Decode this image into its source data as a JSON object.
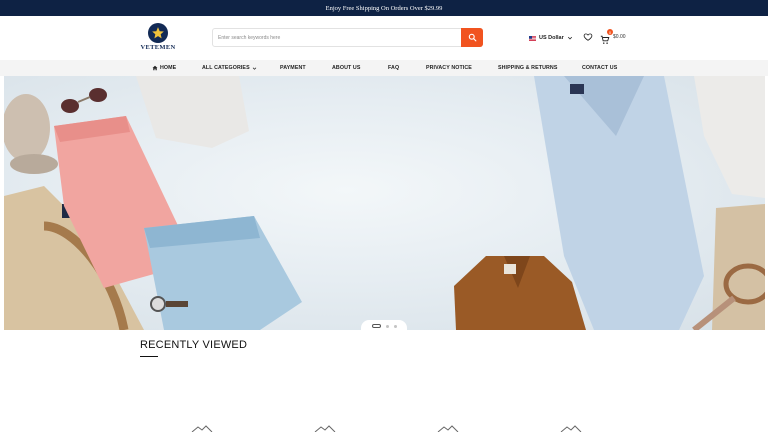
{
  "topbar": {
    "text": "Enjoy Free Shipping On Orders Over $29.99"
  },
  "header": {
    "logo_text": "VETEMEN",
    "search": {
      "placeholder": "Enter search keywords here"
    },
    "currency": {
      "label": "US Dollar"
    },
    "cart": {
      "count": "0",
      "total": "$0.00"
    }
  },
  "nav": {
    "items": [
      {
        "label": "HOME"
      },
      {
        "label": "ALL CATEGORIES"
      },
      {
        "label": "PAYMENT"
      },
      {
        "label": "ABOUT US"
      },
      {
        "label": "FAQ"
      },
      {
        "label": "PRIVACY NOTICE"
      },
      {
        "label": "SHIPPING & RETURNS"
      },
      {
        "label": "CONTACT US"
      }
    ]
  },
  "hero": {
    "slide_count": 3,
    "active_slide": 1
  },
  "recently_viewed": {
    "title": "RECENTLY VIEWED"
  },
  "colors": {
    "topbar": "#0e2244",
    "accent": "#f1531f",
    "logo": "#122a55"
  }
}
